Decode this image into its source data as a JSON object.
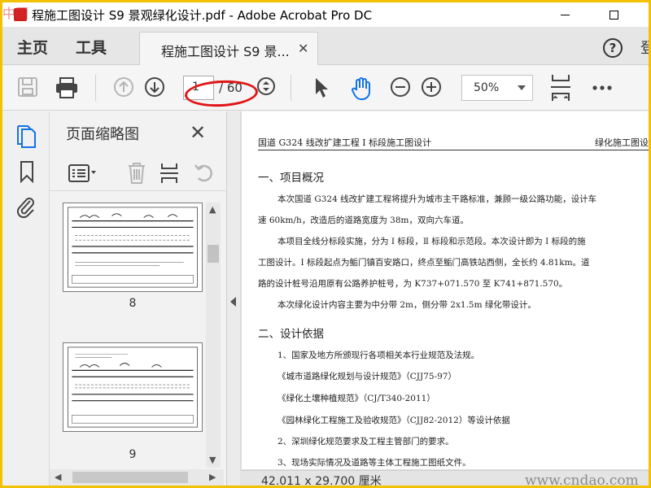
{
  "window": {
    "title": "程施工图设计 S9 景观绿化设计.pdf - Adobe Acrobat Pro DC",
    "corner_logo": "中国"
  },
  "tabs": {
    "home": "主页",
    "tools": "工具",
    "document": "程施工图设计 S9 景...",
    "signin": "登"
  },
  "toolbar": {
    "current_page": "1",
    "total_pages": "/ 60",
    "zoom": "50%"
  },
  "thumbnails": {
    "title": "页面缩略图",
    "pages": [
      "8",
      "9"
    ]
  },
  "document": {
    "header_left": "国道 G324 线改扩建工程 Ⅰ 标段施工图设计",
    "header_right": "绿化施工图设",
    "section1": "一、项目概况",
    "p1a": "本次国道 G324 线改扩建工程将提升为城市主干路标准，兼顾一级公路功能，设计车",
    "p1b": "速 60km/h，改造后的道路宽度为 38m，双向六车道。",
    "p2a": "本项目全线分标段实施，分为 Ⅰ 标段，Ⅱ 标段和示范段。本次设计即为 Ⅰ 标段的施",
    "p2b": "工图设计。Ⅰ 标段起点为鲘门镇百安路口，终点至鲘门高铁站西侧，全长约 4.81km。道",
    "p2c": "路的设计桩号沿用原有公路养护桩号，为 K737+071.570 至 K741+871.570。",
    "p3": "本次绿化设计内容主要为中分带 2m，侧分带 2x1.5m 绿化带设计。",
    "section2": "二、设计依据",
    "b1": "1、国家及地方所颁现行各项相关本行业规范及法规。",
    "b2": "《城市道路绿化规划与设计规范》（CJJ75-97）",
    "b3": "《绿化土壤种植规范》（CJ/T340-2011）",
    "b4": "《园林绿化工程施工及验收规范》（CJJ82-2012）等设计依据",
    "b5": "2、深圳绿化规范要求及工程主管部门的要求。",
    "b6": "3、现场实际情况及道路等主体工程施工图纸文件。"
  },
  "status": {
    "page_size": "42.011 x 29.700 厘米",
    "watermark": "www.cndao.com"
  },
  "colors": {
    "frame": "#f2c200",
    "annotation": "#e01616",
    "accent_blue": "#1473e6"
  }
}
